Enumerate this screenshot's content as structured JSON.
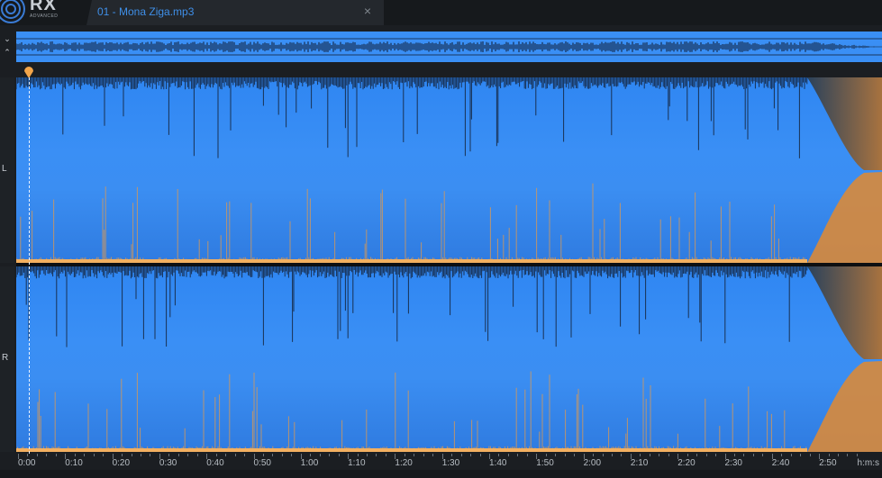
{
  "app": {
    "logo_text": "RX",
    "logo_sub": "ADVANCED"
  },
  "tab": {
    "title": "01 - Mona Ziga.mp3",
    "close_glyph": "×"
  },
  "overview": {
    "collapse_glyphs": [
      "⌄",
      "⌃"
    ]
  },
  "channels": [
    {
      "label": "L"
    },
    {
      "label": "R"
    }
  ],
  "ruler": {
    "unit": "h:m:s",
    "labels": [
      "0:00",
      "0:10",
      "0:20",
      "0:30",
      "0:40",
      "0:50",
      "1:00",
      "1:10",
      "1:20",
      "1:30",
      "1:40",
      "1:50",
      "2:00",
      "2:10",
      "2:20",
      "2:30",
      "2:40",
      "2:50"
    ]
  },
  "colors": {
    "spectrogram_blue": "#3a8ff5",
    "waveform_dark": "#0f1a2e",
    "energy_orange": "#f3a54a",
    "accent": "#3f8fe8"
  },
  "icons": {
    "playhead": "playhead-marker-icon",
    "logo": "rx-logo-icon",
    "close": "close-icon",
    "collapse": "chevron-collapse-icon"
  }
}
